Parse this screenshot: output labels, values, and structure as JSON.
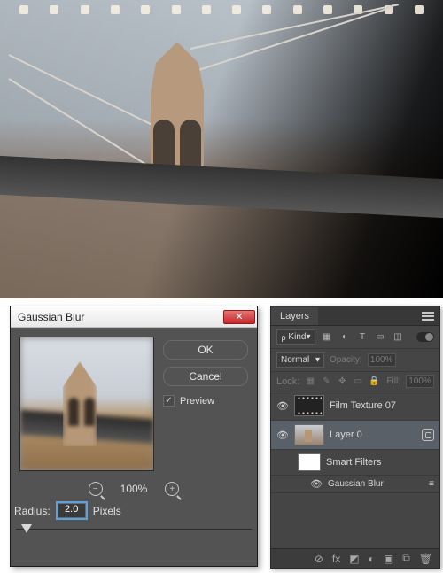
{
  "dialog": {
    "title": "Gaussian Blur",
    "ok": "OK",
    "cancel": "Cancel",
    "preview_label": "Preview",
    "preview_checked": true,
    "zoom_level": "100%",
    "radius_label": "Radius:",
    "radius_value": "2.0",
    "radius_unit": "Pixels"
  },
  "layers_panel": {
    "tab": "Layers",
    "kind_label": "Kind",
    "blend_mode": "Normal",
    "opacity_label": "Opacity:",
    "opacity_value": "100%",
    "lock_label": "Lock:",
    "fill_label": "Fill:",
    "fill_value": "100%",
    "layers": [
      {
        "name": "Film Texture 07",
        "visible": true,
        "selected": false
      },
      {
        "name": "Layer 0",
        "visible": true,
        "selected": true,
        "smart_object": true
      }
    ],
    "smart_filters_label": "Smart Filters",
    "filter_entry": "Gaussian Blur"
  }
}
